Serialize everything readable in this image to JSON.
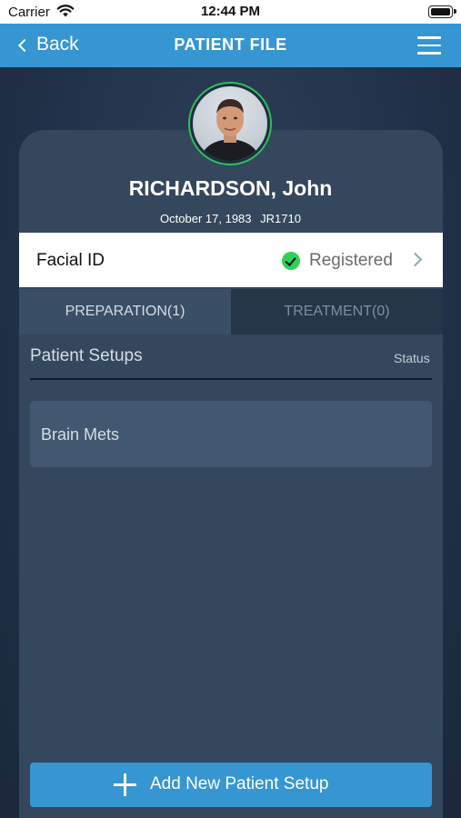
{
  "status_bar": {
    "carrier": "Carrier",
    "time": "12:44 PM",
    "battery_level": 1.0
  },
  "nav": {
    "back_label": "Back",
    "title": "PATIENT FILE",
    "menu_icon": "hamburger-menu-icon"
  },
  "patient": {
    "name": "RICHARDSON, John",
    "dob": "October 17, 1983",
    "id": "JR1710"
  },
  "facial_id": {
    "label": "Facial ID",
    "status": "Registered",
    "status_color": "#2fd05a"
  },
  "tabs": [
    {
      "label": "PREPARATION(1)",
      "active": true
    },
    {
      "label": "TREATMENT(0)",
      "active": false
    }
  ],
  "setups": {
    "title": "Patient Setups",
    "status_header": "Status",
    "items": [
      {
        "label": "Brain Mets"
      }
    ]
  },
  "add_button": {
    "label": "Add New Patient Setup"
  },
  "colors": {
    "accent": "#3596d2",
    "card": "#34475d",
    "background": "#22324a"
  }
}
